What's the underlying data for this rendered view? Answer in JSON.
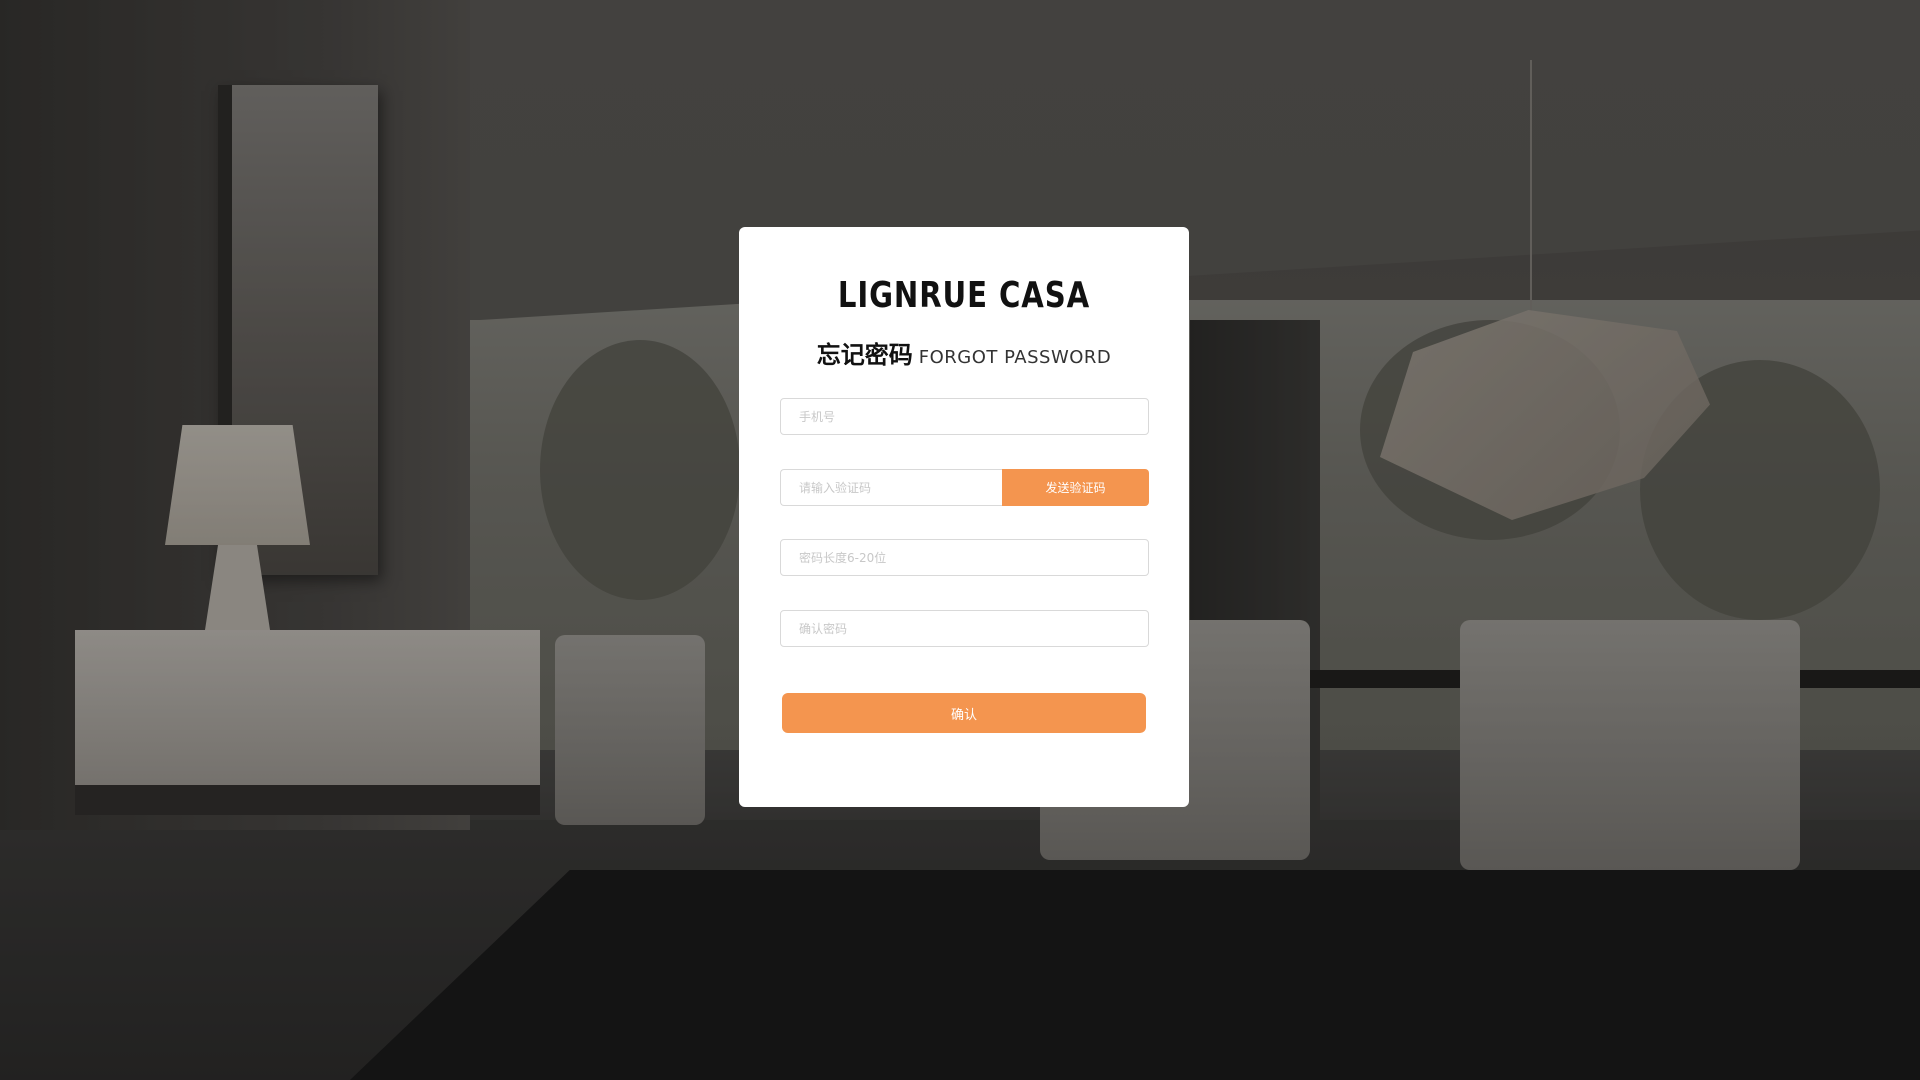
{
  "brand": {
    "logo_text": "LIGNRUE CASA"
  },
  "page": {
    "title_cn": "忘记密码",
    "title_en": "FORGOT PASSWORD"
  },
  "form": {
    "phone_placeholder": "手机号",
    "code_placeholder": "请输入验证码",
    "send_code_label": "发送验证码",
    "password_placeholder": "密码长度6-20位",
    "confirm_password_placeholder": "确认密码",
    "submit_label": "确认"
  },
  "colors": {
    "accent": "#f4954f",
    "card_background": "#ffffff"
  }
}
